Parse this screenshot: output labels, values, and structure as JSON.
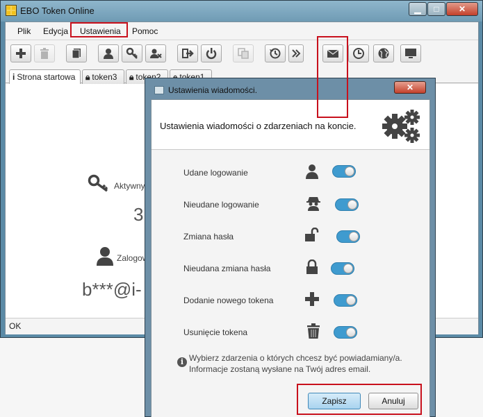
{
  "window": {
    "title": "EBO Token Online",
    "controls": {
      "minimize": "▁",
      "maximize": "□",
      "close": "✕"
    }
  },
  "menu": [
    "Plik",
    "Edycja",
    "Ustawienia",
    "Pomoc"
  ],
  "toolbar_icons": [
    "add-icon",
    "trash-icon",
    "book-icon",
    "user-icon",
    "key-icon",
    "user-delete-icon",
    "logout-icon",
    "power-icon",
    "copy-icon",
    "history-icon",
    "double-chevron-icon",
    "envelope-icon",
    "clock-icon",
    "globe-icon",
    "monitor-icon"
  ],
  "tabs": [
    {
      "icon": "i",
      "label": "Strona startowa"
    },
    {
      "icon": "lock",
      "label": "token3"
    },
    {
      "icon": "lock",
      "label": "token2"
    },
    {
      "icon": "lock",
      "label": "token1"
    }
  ],
  "background": {
    "active_label": "Aktywnych",
    "active_count": "3",
    "logged_label": "Zalogow",
    "email_masked": "b***@i-"
  },
  "status": "OK",
  "dialog": {
    "title": "Ustawienia wiadomości.",
    "close": "✕",
    "header": "Ustawienia wiadomości o zdarzeniach na koncie.",
    "rows": [
      {
        "label": "Udane logowanie",
        "icon": "user-icon",
        "enabled": true
      },
      {
        "label": "Nieudane logowanie",
        "icon": "spy-icon",
        "enabled": true
      },
      {
        "label": "Zmiana hasła",
        "icon": "unlock-icon",
        "enabled": true
      },
      {
        "label": "Nieudana zmiana hasła",
        "icon": "lock-icon",
        "enabled": true
      },
      {
        "label": "Dodanie nowego tokena",
        "icon": "plus-icon",
        "enabled": true
      },
      {
        "label": "Usunięcie tokena",
        "icon": "trash-icon",
        "enabled": true
      }
    ],
    "info_line1": "Wybierz zdarzenia o których chcesz być powiadamiany/a.",
    "info_line2": "Informacje zostaną wysłane na Twój adres email.",
    "save": "Zapisz",
    "cancel": "Anuluj"
  },
  "colors": {
    "highlight": "#c8101c",
    "toggle_on": "#3f9bcf",
    "titlebar": "#6f9bb4"
  }
}
